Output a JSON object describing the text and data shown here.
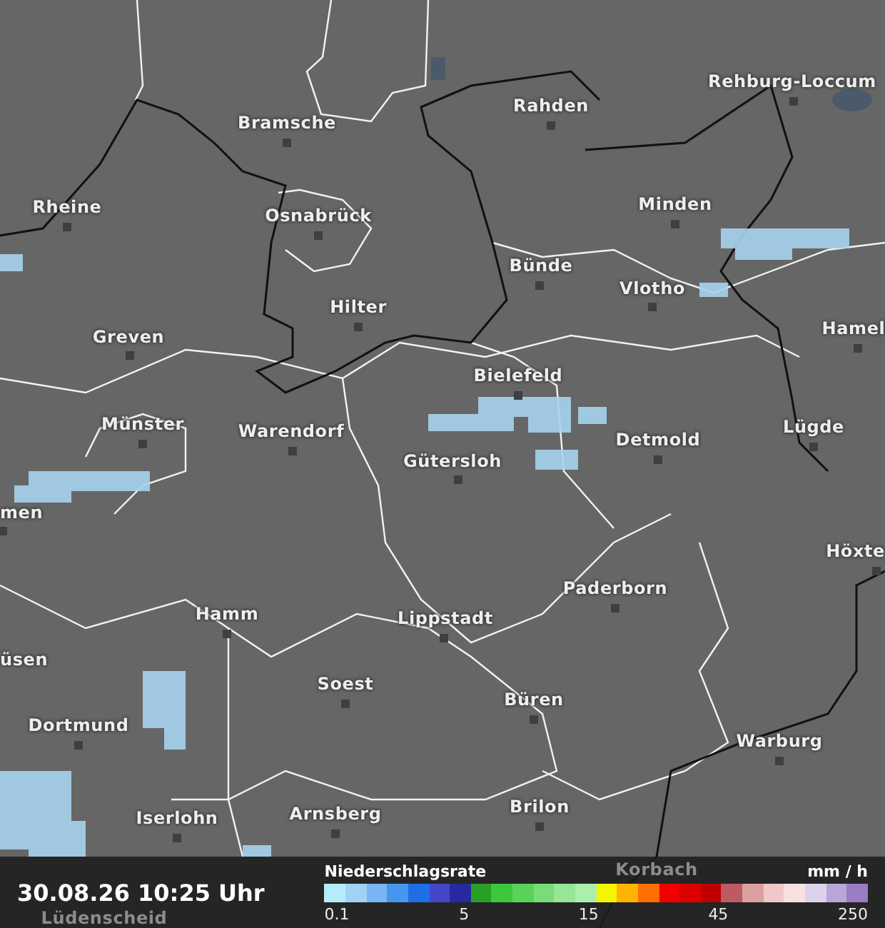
{
  "map": {
    "places": [
      {
        "name": "Rehburg-Loccum"
      },
      {
        "name": "Rahden"
      },
      {
        "name": "Bramsche"
      },
      {
        "name": "Rheine"
      },
      {
        "name": "Minden"
      },
      {
        "name": "Osnabrück"
      },
      {
        "name": "Bünde"
      },
      {
        "name": "Vlotho"
      },
      {
        "name": "Hilter"
      },
      {
        "name": "Hamel"
      },
      {
        "name": "Greven"
      },
      {
        "name": "Bielefeld"
      },
      {
        "name": "Münster"
      },
      {
        "name": "Warendorf"
      },
      {
        "name": "Detmold"
      },
      {
        "name": "Lügde"
      },
      {
        "name": "Gütersloh"
      },
      {
        "name": "men"
      },
      {
        "name": "Höxte"
      },
      {
        "name": "Paderborn"
      },
      {
        "name": "Hamm"
      },
      {
        "name": "Lippstadt"
      },
      {
        "name": "üsen"
      },
      {
        "name": "Soest"
      },
      {
        "name": "Büren"
      },
      {
        "name": "Dortmund"
      },
      {
        "name": "Warburg"
      },
      {
        "name": "Brilon"
      },
      {
        "name": "Iserlohn"
      },
      {
        "name": "Arnsberg"
      },
      {
        "name": "Korbach"
      },
      {
        "name": "Lüdenscheid"
      }
    ]
  },
  "footer": {
    "timestamp": "30.08.26 10:25 Uhr",
    "legend": {
      "title": "Niederschlagsrate",
      "unit": "mm / h",
      "scale": [
        {
          "color": "#b4ecfc"
        },
        {
          "color": "#a0d2f6"
        },
        {
          "color": "#78b4f2"
        },
        {
          "color": "#4696ee"
        },
        {
          "color": "#1e6ee6"
        },
        {
          "color": "#4646c8"
        },
        {
          "color": "#2828a0"
        },
        {
          "color": "#28a028"
        },
        {
          "color": "#3cc83c"
        },
        {
          "color": "#5ad25a"
        },
        {
          "color": "#78dc78"
        },
        {
          "color": "#96e696"
        },
        {
          "color": "#aaf0aa"
        },
        {
          "color": "#f5f500"
        },
        {
          "color": "#ffb400"
        },
        {
          "color": "#ff6e00"
        },
        {
          "color": "#f00000"
        },
        {
          "color": "#dc0000"
        },
        {
          "color": "#be0000"
        },
        {
          "color": "#be5a64"
        },
        {
          "color": "#dca0a0"
        },
        {
          "color": "#f0c8c8"
        },
        {
          "color": "#fae1e1"
        },
        {
          "color": "#dcd2eb"
        },
        {
          "color": "#b9a5d7"
        },
        {
          "color": "#9b7dc3"
        }
      ],
      "ticks": [
        "0.1",
        "5",
        "15",
        "45",
        "250"
      ]
    }
  }
}
